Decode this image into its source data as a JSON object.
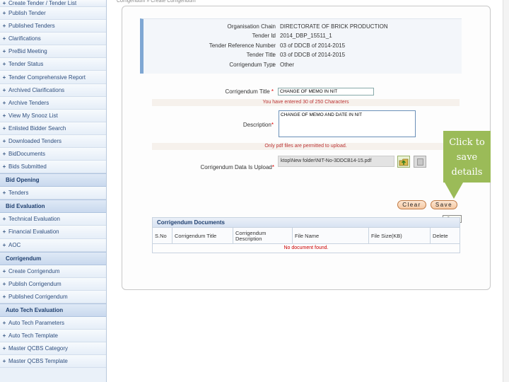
{
  "breadcrumb": "Corrigendum » Create Corrigendum",
  "sidebar": {
    "top_item": "Create Tender / Tender List",
    "group1": [
      "Publish Tender",
      "Published Tenders",
      "Clarifications",
      "PreBid Meeting",
      "Tender Status",
      "Tender Comprehensive Report",
      "Archived Clarifications",
      "Archive Tenders",
      "View My Snooz List",
      "Enlisted Bidder Search",
      "Downloaded Tenders",
      "BidDocuments",
      "Bids Submitted"
    ],
    "header_bid_opening": "Bid Opening",
    "group2": [
      "Tenders"
    ],
    "header_bid_evaluation": "Bid Evaluation",
    "group3": [
      "Technical Evaluation",
      "Financial Evaluation",
      "AOC"
    ],
    "header_corrigendum": "Corrigendum",
    "group4": [
      "Create Corrigendum",
      "Publish Corrigendum",
      "Published Corrigendum"
    ],
    "header_auto_tech": "Auto Tech Evaluation",
    "group5": [
      "Auto Tech Parameters",
      "Auto Tech Template",
      "Master QCBS Category",
      "Master QCBS Template"
    ]
  },
  "info": [
    {
      "key": "Organisation Chain",
      "value": "DIRECTORATE OF BRICK PRODUCTION"
    },
    {
      "key": "Tender Id",
      "value": "2014_DBP_15511_1"
    },
    {
      "key": "Tender Reference Number",
      "value": "03 of DDCB of 2014-2015"
    },
    {
      "key": "Tender Title",
      "value": "03 of DDCB of 2014-2015"
    },
    {
      "key": "Corrigendum Type",
      "value": "Other"
    }
  ],
  "form": {
    "title_label": "Corrigendum Title",
    "title_value": "CHANGE OF MEMO IN NIT",
    "counter_text": "You have entered 30 of 250 Characters",
    "desc_label": "Description",
    "desc_value": "CHANGE OF MEMO AND DATE IN NIT",
    "pdf_hint": "Only pdf files are permitted to upload.",
    "upload_label": "Corrigendum Data Is Upload",
    "file_value": "ktop\\New folder\\NIT-No-3DDCB14-15.pdf"
  },
  "buttons": {
    "clear": "Clear",
    "save": "Save",
    "tooltip": "Save"
  },
  "callout": {
    "text": "Click to\nsave\ndetails"
  },
  "docs": {
    "title": "Corrigendum Documents",
    "columns": [
      "S.No",
      "Corrigendum Title",
      "Corrigendum Description",
      "File Name",
      "File Size(KB)",
      "Delete"
    ],
    "empty": "No document found."
  },
  "colors": {
    "accent": "#7fa7d3",
    "callout": "#9bbb58",
    "button": "#f5c9a4"
  }
}
